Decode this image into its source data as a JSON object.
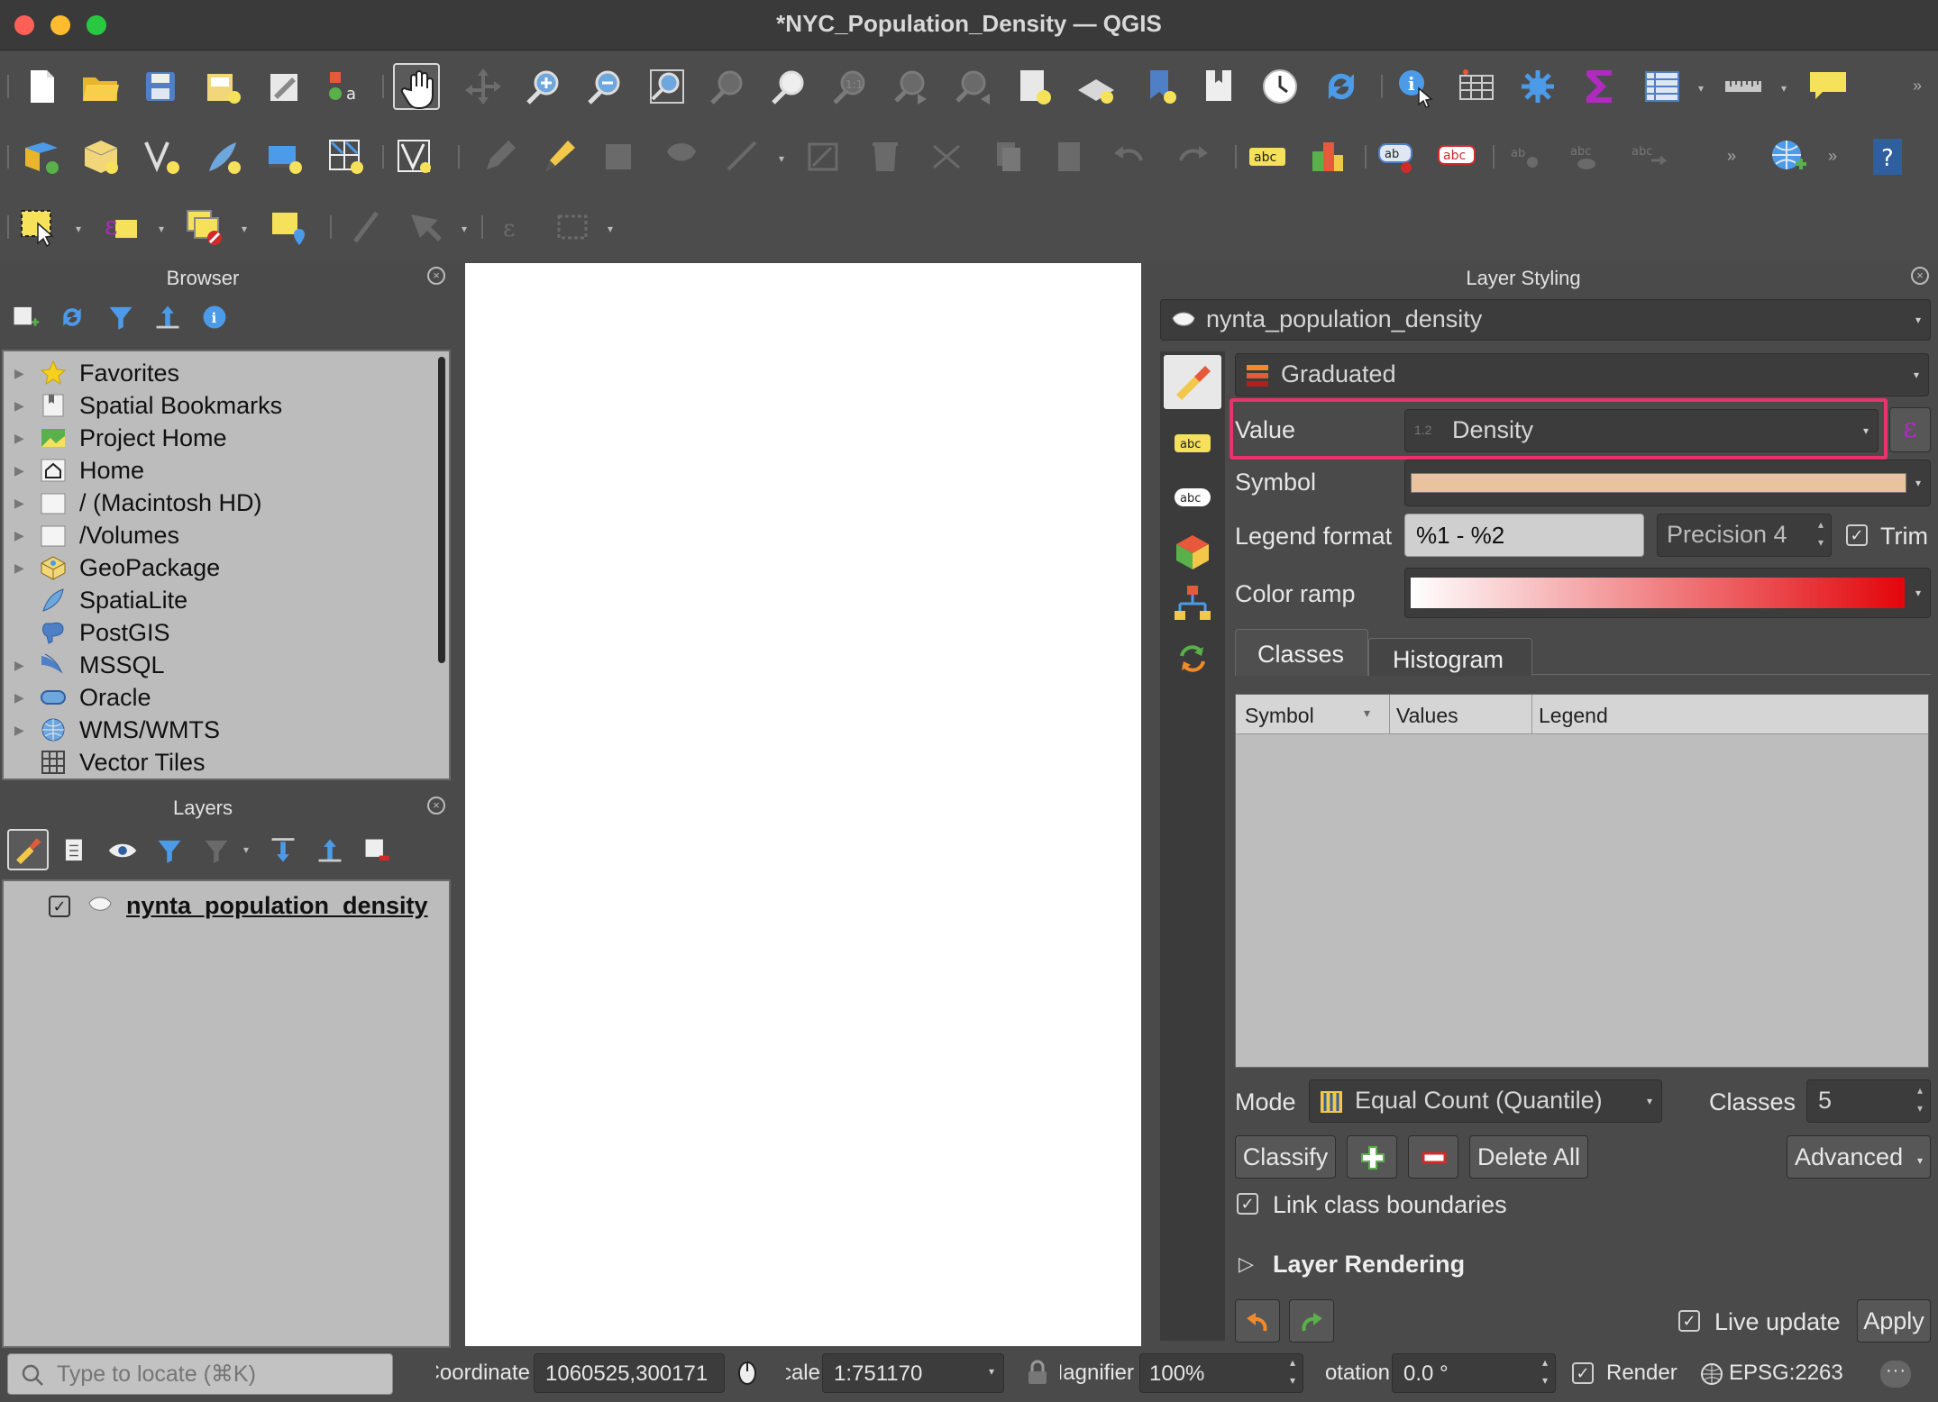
{
  "window": {
    "title": "*NYC_Population_Density — QGIS"
  },
  "browser": {
    "title": "Browser",
    "items": [
      {
        "label": "Favorites",
        "icon": "star-icon"
      },
      {
        "label": "Spatial Bookmarks",
        "icon": "bookmark-icon"
      },
      {
        "label": "Project Home",
        "icon": "project-home-icon"
      },
      {
        "label": "Home",
        "icon": "home-icon"
      },
      {
        "label": "/ (Macintosh HD)",
        "icon": "folder-icon"
      },
      {
        "label": "/Volumes",
        "icon": "folder-icon"
      },
      {
        "label": "GeoPackage",
        "icon": "geopackage-icon"
      },
      {
        "label": "SpatiaLite",
        "icon": "spatialite-icon"
      },
      {
        "label": "PostGIS",
        "icon": "postgis-icon"
      },
      {
        "label": "MSSQL",
        "icon": "mssql-icon"
      },
      {
        "label": "Oracle",
        "icon": "oracle-icon"
      },
      {
        "label": "WMS/WMTS",
        "icon": "globe-icon"
      },
      {
        "label": "Vector Tiles",
        "icon": "grid-icon"
      }
    ]
  },
  "layers": {
    "title": "Layers",
    "items": [
      {
        "label": "nynta_population_density",
        "checked": true
      }
    ]
  },
  "styling": {
    "title": "Layer Styling",
    "layer_name": "nynta_population_density",
    "renderer": "Graduated",
    "value_label": "Value",
    "value_type_hint": "1.2",
    "value_field": "Density",
    "expression_symbol": "ε",
    "symbol_label": "Symbol",
    "legend_format_label": "Legend format",
    "legend_format": "%1 - %2",
    "precision": "Precision 4",
    "trim_label": "Trim",
    "color_ramp_label": "Color ramp",
    "tabs": [
      "Classes",
      "Histogram"
    ],
    "columns": [
      "Symbol",
      "Values",
      "Legend"
    ],
    "mode_label": "Mode",
    "mode": "Equal Count (Quantile)",
    "classes_label": "Classes",
    "classes_count": "5",
    "classify_label": "Classify",
    "add_label": "+",
    "remove_label": "−",
    "delete_all_label": "Delete All",
    "advanced_label": "Advanced",
    "link_boundaries_label": "Link class boundaries",
    "layer_rendering_label": "Layer Rendering",
    "live_update_label": "Live update",
    "apply_label": "Apply",
    "colors": {
      "symbol_fill": "#e8c39e",
      "ramp_start": "#ffffff",
      "ramp_end": "#e3050a",
      "highlight": "#e8336d"
    }
  },
  "status": {
    "locate_placeholder": "Type to locate (⌘K)",
    "coordinate_label": "Coordinate",
    "coordinate_value": "1060525,300171",
    "scale_label": "Scale",
    "scale_value": "1:751170",
    "magnifier_label": "Magnifier",
    "magnifier_value": "100%",
    "rotation_label": "Rotation",
    "rotation_value": "0.0 °",
    "render_label": "Render",
    "crs": "EPSG:2263"
  }
}
